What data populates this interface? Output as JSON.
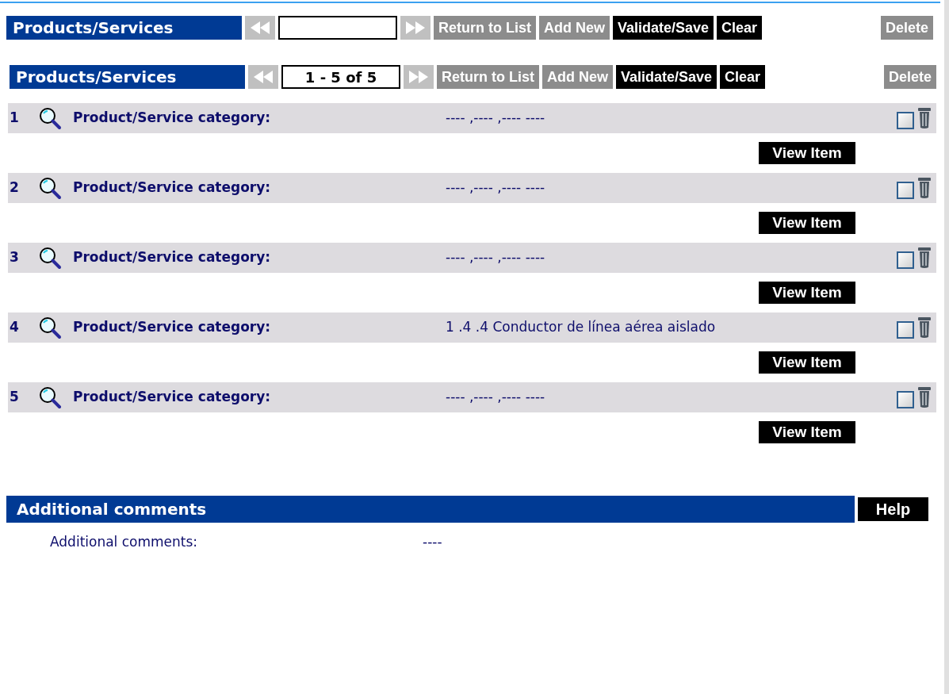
{
  "toolbars": [
    {
      "title": "Products/Services",
      "prev_disabled": true,
      "next_disabled": true,
      "buttons": [
        {
          "label": "Return to List",
          "disabled": true
        },
        {
          "label": "Add New",
          "disabled": true
        },
        {
          "label": "Validate/Save",
          "disabled": false
        },
        {
          "label": "Clear",
          "disabled": false
        }
      ],
      "delete_button": {
        "label": "Delete",
        "disabled": true
      }
    },
    {
      "title": "Products/Services",
      "prev_disabled": true,
      "page_field": {
        "value": "1 - 5 of 5"
      },
      "next_disabled": true,
      "buttons": [
        {
          "label": "Return to List",
          "disabled": true
        },
        {
          "label": "Add New",
          "disabled": true
        },
        {
          "label": "Validate/Save",
          "disabled": false
        },
        {
          "label": "Clear",
          "disabled": false
        }
      ],
      "delete_button": {
        "label": "Delete",
        "disabled": true
      }
    }
  ],
  "items": [
    {
      "number": "1",
      "label": "Product/Service category:",
      "value": "---- ,---- ,---- ----",
      "checked": false,
      "view_button": "View Item"
    },
    {
      "number": "2",
      "label": "Product/Service category:",
      "value": "---- ,---- ,---- ----",
      "checked": false,
      "view_button": "View Item"
    },
    {
      "number": "3",
      "label": "Product/Service category:",
      "value": "---- ,---- ,---- ----",
      "checked": false,
      "view_button": "View Item"
    },
    {
      "number": "4",
      "label": "Product/Service category:",
      "value": "1 .4 .4 Conductor de línea aérea aislado",
      "checked": false,
      "view_button": "View Item"
    },
    {
      "number": "5",
      "label": "Product/Service category:",
      "value": "---- ,---- ,---- ----",
      "checked": false,
      "view_button": "View Item"
    }
  ],
  "comments": {
    "title": "Additional comments",
    "help_button": "Help",
    "label": "Additional comments:",
    "value": "----"
  }
}
